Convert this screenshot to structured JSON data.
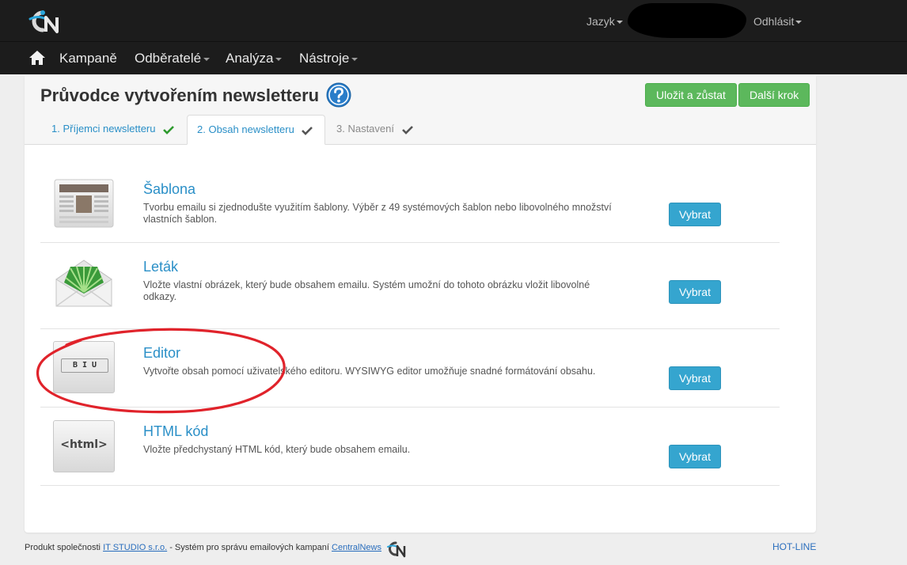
{
  "navbar": {
    "utility": {
      "language_label": "Jazyk",
      "logout_label": "Odhlásit"
    },
    "menu": [
      {
        "label": "Kampaně",
        "has_dropdown": false
      },
      {
        "label": "Odběratelé",
        "has_dropdown": true
      },
      {
        "label": "Analýza",
        "has_dropdown": true
      },
      {
        "label": "Nástroje",
        "has_dropdown": true
      }
    ]
  },
  "header": {
    "title": "Průvodce vytvořením newsletteru",
    "save_stay_label": "Uložit a zůstat",
    "next_step_label": "Další krok"
  },
  "tabs": [
    {
      "label": "1. Příjemci newsletteru",
      "state": "done"
    },
    {
      "label": "2. Obsah newsletteru",
      "state": "active"
    },
    {
      "label": "3. Nastavení",
      "state": "inactive"
    }
  ],
  "options": [
    {
      "title": "Šablona",
      "description": "Tvorbu emailu si zjednodušte využitím šablony. Výběr z 49 systémových šablon nebo libovolného množství vlastních šablon.",
      "button_label": "Vybrat"
    },
    {
      "title": "Leták",
      "description": "Vložte vlastní obrázek, který bude obsahem emailu. Systém umožní do tohoto obrázku vložit libovolné odkazy.",
      "button_label": "Vybrat"
    },
    {
      "title": "Editor",
      "description": "Vytvořte obsah pomocí uživatelského editoru. WYSIWYG editor umožňuje snadné formátování obsahu.",
      "button_label": "Vybrat",
      "icon_text": "B I U"
    },
    {
      "title": "HTML kód",
      "description": "Vložte předchystaný HTML kód, který bude obsahem emailu.",
      "button_label": "Vybrat",
      "icon_text": "<html>"
    }
  ],
  "footer": {
    "prefix": "Produkt společnosti ",
    "company_link": "IT STUDIO s.r.o.",
    "middle": " - Systém pro správu emailových kampaní ",
    "product_link": "CentralNews",
    "hotline": "HOT-LINE"
  },
  "colors": {
    "navbar_bg": "#1c1c1c",
    "link_blue": "#2a8fc7",
    "select_button": "#35a5cf",
    "green_button": "#5cb85c",
    "annotation_red": "#e0232b"
  },
  "icons": [
    "logo-icon",
    "home-icon",
    "help-icon",
    "check-icon",
    "template-icon",
    "envelope-icon",
    "editor-icon",
    "html-icon"
  ]
}
